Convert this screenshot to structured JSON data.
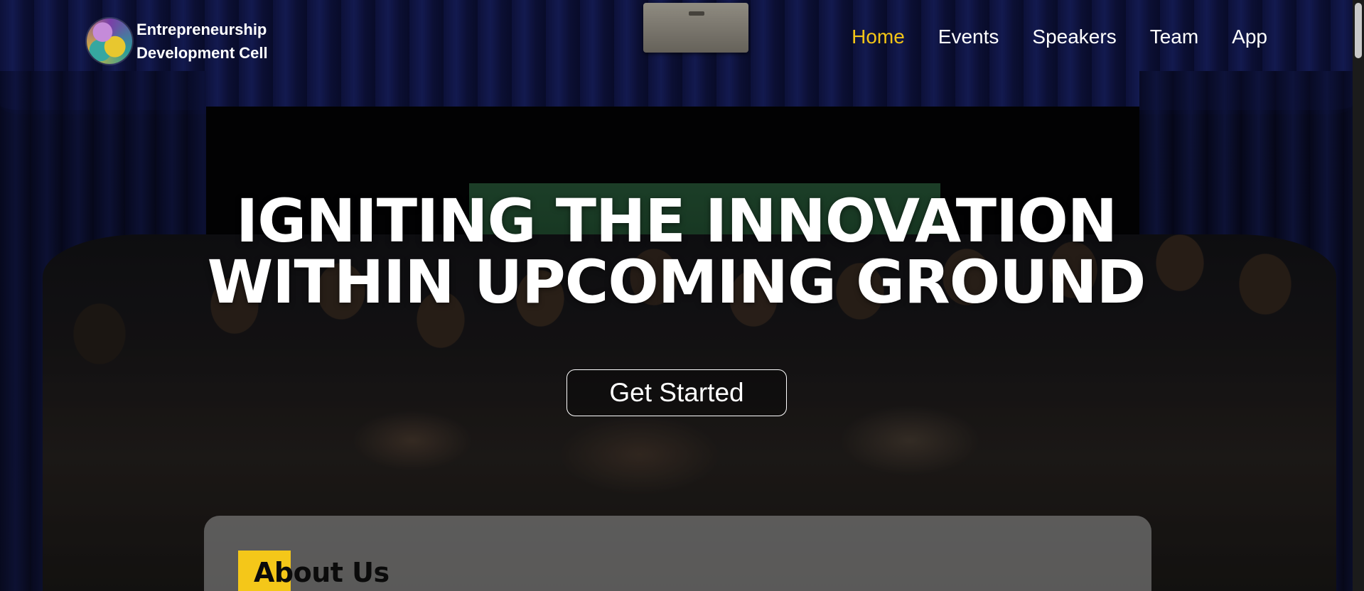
{
  "header": {
    "brand": {
      "logo_icon": "edc-globe-logo-icon",
      "line1": "Entrepreneurship",
      "line2": "Development Cell"
    },
    "nav": [
      {
        "label": "Home",
        "active": true
      },
      {
        "label": "Events",
        "active": false
      },
      {
        "label": "Speakers",
        "active": false
      },
      {
        "label": "Team",
        "active": false
      },
      {
        "label": "App",
        "active": false
      }
    ]
  },
  "hero": {
    "title_line1": "IGNITING THE INNOVATION",
    "title_line2": "WITHIN UPCOMING GROUND",
    "cta_label": "Get Started"
  },
  "about": {
    "heading": "About Us"
  },
  "colors": {
    "accent": "#f3c517",
    "text": "#ffffff",
    "card": "#969696"
  }
}
